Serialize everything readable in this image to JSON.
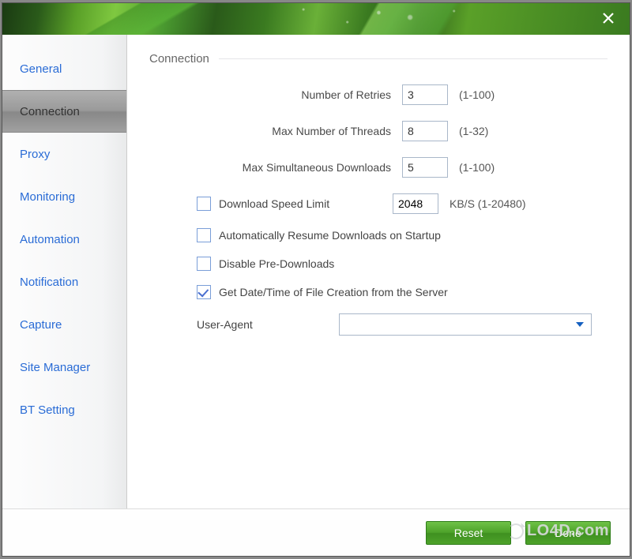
{
  "titlebar": {
    "close_tooltip": "Close"
  },
  "sidebar": {
    "items": [
      {
        "label": "General"
      },
      {
        "label": "Connection"
      },
      {
        "label": "Proxy"
      },
      {
        "label": "Monitoring"
      },
      {
        "label": "Automation"
      },
      {
        "label": "Notification"
      },
      {
        "label": "Capture"
      },
      {
        "label": "Site Manager"
      },
      {
        "label": "BT Setting"
      }
    ],
    "active_index": 1
  },
  "main": {
    "title": "Connection",
    "retries": {
      "label": "Number of Retries",
      "value": "3",
      "hint": "(1-100)"
    },
    "threads": {
      "label": "Max Number of Threads",
      "value": "8",
      "hint": "(1-32)"
    },
    "simul": {
      "label": "Max Simultaneous Downloads",
      "value": "5",
      "hint": "(1-100)"
    },
    "speedlimit": {
      "checked": false,
      "label": "Download Speed Limit",
      "value": "2048",
      "hint": "KB/S (1-20480)"
    },
    "autoresume": {
      "checked": false,
      "label": "Automatically Resume Downloads on Startup"
    },
    "disablepre": {
      "checked": false,
      "label": "Disable Pre-Downloads"
    },
    "getdate": {
      "checked": true,
      "label": "Get Date/Time of File Creation from the Server"
    },
    "useragent": {
      "label": "User-Agent",
      "value": ""
    }
  },
  "footer": {
    "reset": "Reset",
    "done": "Done"
  },
  "watermark": "LO4D.com"
}
